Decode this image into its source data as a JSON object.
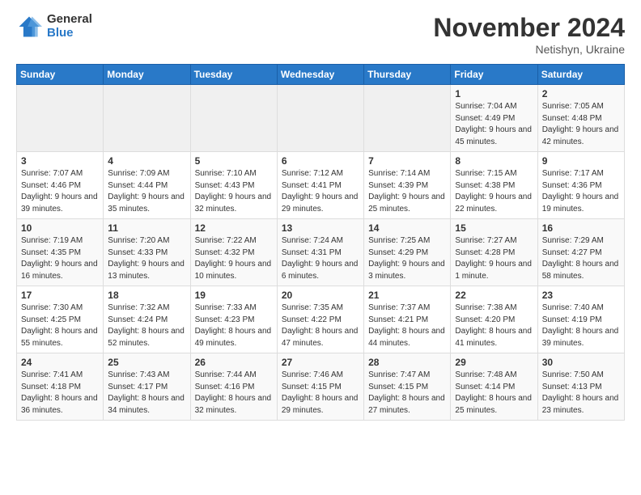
{
  "logo": {
    "general": "General",
    "blue": "Blue"
  },
  "header": {
    "month": "November 2024",
    "location": "Netishyn, Ukraine"
  },
  "weekdays": [
    "Sunday",
    "Monday",
    "Tuesday",
    "Wednesday",
    "Thursday",
    "Friday",
    "Saturday"
  ],
  "weeks": [
    [
      {
        "day": "",
        "info": ""
      },
      {
        "day": "",
        "info": ""
      },
      {
        "day": "",
        "info": ""
      },
      {
        "day": "",
        "info": ""
      },
      {
        "day": "",
        "info": ""
      },
      {
        "day": "1",
        "info": "Sunrise: 7:04 AM\nSunset: 4:49 PM\nDaylight: 9 hours and 45 minutes."
      },
      {
        "day": "2",
        "info": "Sunrise: 7:05 AM\nSunset: 4:48 PM\nDaylight: 9 hours and 42 minutes."
      }
    ],
    [
      {
        "day": "3",
        "info": "Sunrise: 7:07 AM\nSunset: 4:46 PM\nDaylight: 9 hours and 39 minutes."
      },
      {
        "day": "4",
        "info": "Sunrise: 7:09 AM\nSunset: 4:44 PM\nDaylight: 9 hours and 35 minutes."
      },
      {
        "day": "5",
        "info": "Sunrise: 7:10 AM\nSunset: 4:43 PM\nDaylight: 9 hours and 32 minutes."
      },
      {
        "day": "6",
        "info": "Sunrise: 7:12 AM\nSunset: 4:41 PM\nDaylight: 9 hours and 29 minutes."
      },
      {
        "day": "7",
        "info": "Sunrise: 7:14 AM\nSunset: 4:39 PM\nDaylight: 9 hours and 25 minutes."
      },
      {
        "day": "8",
        "info": "Sunrise: 7:15 AM\nSunset: 4:38 PM\nDaylight: 9 hours and 22 minutes."
      },
      {
        "day": "9",
        "info": "Sunrise: 7:17 AM\nSunset: 4:36 PM\nDaylight: 9 hours and 19 minutes."
      }
    ],
    [
      {
        "day": "10",
        "info": "Sunrise: 7:19 AM\nSunset: 4:35 PM\nDaylight: 9 hours and 16 minutes."
      },
      {
        "day": "11",
        "info": "Sunrise: 7:20 AM\nSunset: 4:33 PM\nDaylight: 9 hours and 13 minutes."
      },
      {
        "day": "12",
        "info": "Sunrise: 7:22 AM\nSunset: 4:32 PM\nDaylight: 9 hours and 10 minutes."
      },
      {
        "day": "13",
        "info": "Sunrise: 7:24 AM\nSunset: 4:31 PM\nDaylight: 9 hours and 6 minutes."
      },
      {
        "day": "14",
        "info": "Sunrise: 7:25 AM\nSunset: 4:29 PM\nDaylight: 9 hours and 3 minutes."
      },
      {
        "day": "15",
        "info": "Sunrise: 7:27 AM\nSunset: 4:28 PM\nDaylight: 9 hours and 1 minute."
      },
      {
        "day": "16",
        "info": "Sunrise: 7:29 AM\nSunset: 4:27 PM\nDaylight: 8 hours and 58 minutes."
      }
    ],
    [
      {
        "day": "17",
        "info": "Sunrise: 7:30 AM\nSunset: 4:25 PM\nDaylight: 8 hours and 55 minutes."
      },
      {
        "day": "18",
        "info": "Sunrise: 7:32 AM\nSunset: 4:24 PM\nDaylight: 8 hours and 52 minutes."
      },
      {
        "day": "19",
        "info": "Sunrise: 7:33 AM\nSunset: 4:23 PM\nDaylight: 8 hours and 49 minutes."
      },
      {
        "day": "20",
        "info": "Sunrise: 7:35 AM\nSunset: 4:22 PM\nDaylight: 8 hours and 47 minutes."
      },
      {
        "day": "21",
        "info": "Sunrise: 7:37 AM\nSunset: 4:21 PM\nDaylight: 8 hours and 44 minutes."
      },
      {
        "day": "22",
        "info": "Sunrise: 7:38 AM\nSunset: 4:20 PM\nDaylight: 8 hours and 41 minutes."
      },
      {
        "day": "23",
        "info": "Sunrise: 7:40 AM\nSunset: 4:19 PM\nDaylight: 8 hours and 39 minutes."
      }
    ],
    [
      {
        "day": "24",
        "info": "Sunrise: 7:41 AM\nSunset: 4:18 PM\nDaylight: 8 hours and 36 minutes."
      },
      {
        "day": "25",
        "info": "Sunrise: 7:43 AM\nSunset: 4:17 PM\nDaylight: 8 hours and 34 minutes."
      },
      {
        "day": "26",
        "info": "Sunrise: 7:44 AM\nSunset: 4:16 PM\nDaylight: 8 hours and 32 minutes."
      },
      {
        "day": "27",
        "info": "Sunrise: 7:46 AM\nSunset: 4:15 PM\nDaylight: 8 hours and 29 minutes."
      },
      {
        "day": "28",
        "info": "Sunrise: 7:47 AM\nSunset: 4:15 PM\nDaylight: 8 hours and 27 minutes."
      },
      {
        "day": "29",
        "info": "Sunrise: 7:48 AM\nSunset: 4:14 PM\nDaylight: 8 hours and 25 minutes."
      },
      {
        "day": "30",
        "info": "Sunrise: 7:50 AM\nSunset: 4:13 PM\nDaylight: 8 hours and 23 minutes."
      }
    ]
  ]
}
